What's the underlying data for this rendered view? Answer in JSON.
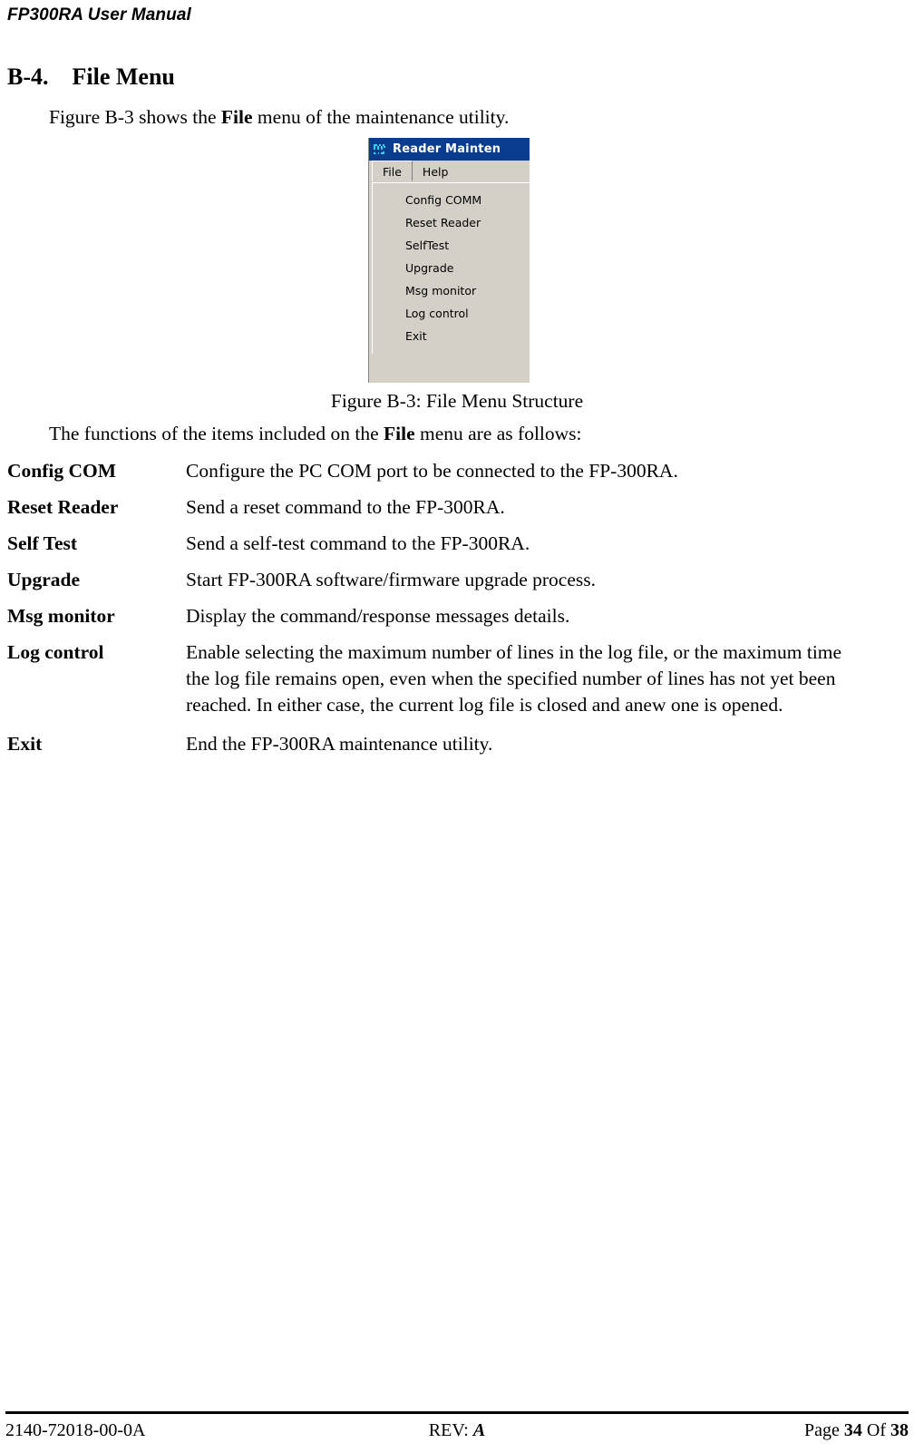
{
  "document": {
    "running_header": "FP300RA User Manual"
  },
  "section": {
    "number": "B-4.",
    "title": "File Menu"
  },
  "intro": {
    "before_bold": "Figure B-3 shows the ",
    "bold": "File",
    "after_bold": " menu of the maintenance utility."
  },
  "figure": {
    "caption": "Figure B-3:  File Menu Structure",
    "app_window": {
      "icon_name": "reader-maintenance-app-icon",
      "title": "Reader Mainten",
      "menubar": [
        {
          "label": "File",
          "state": "open"
        },
        {
          "label": "Help",
          "state": "closed"
        }
      ],
      "dropdown_items": [
        "Config COMM",
        "Reset Reader",
        "SelfTest",
        "Upgrade",
        "Msg monitor",
        "Log control",
        "Exit"
      ],
      "colors": {
        "titlebar": "#0a3c8f",
        "titlebar_text": "#ffffff",
        "chrome": "#d4d0c8",
        "icon_accent": "#2ad4f0"
      }
    }
  },
  "leadin": {
    "before_bold": "The functions of the items included on the ",
    "bold": "File",
    "after_bold": " menu are as follows:"
  },
  "definitions": [
    {
      "term": "Config COM",
      "description": "Configure the PC COM port to be connected to the FP-300RA."
    },
    {
      "term": "Reset Reader",
      "description": "Send a reset command to the FP-300RA."
    },
    {
      "term": "Self Test",
      "description": "Send a self-test command to the FP-300RA."
    },
    {
      "term": "Upgrade",
      "description": "Start FP-300RA software/firmware upgrade process."
    },
    {
      "term": "Msg monitor",
      "description": "Display the command/response messages details."
    },
    {
      "term": "Log control",
      "description": "Enable selecting the maximum number of lines in the log file, or the maximum time the log file remains open, even when the specified number of lines has not yet been reached. In either case, the current log file is closed and anew one is opened."
    },
    {
      "term": "Exit",
      "description": "End the FP-300RA maintenance utility."
    }
  ],
  "footer": {
    "doc_number": "2140-72018-00-0A",
    "rev_label": "REV: ",
    "rev_value": "A",
    "page_label": "Page ",
    "page_number": "34",
    "of_label": " Of  ",
    "page_total": "38"
  }
}
